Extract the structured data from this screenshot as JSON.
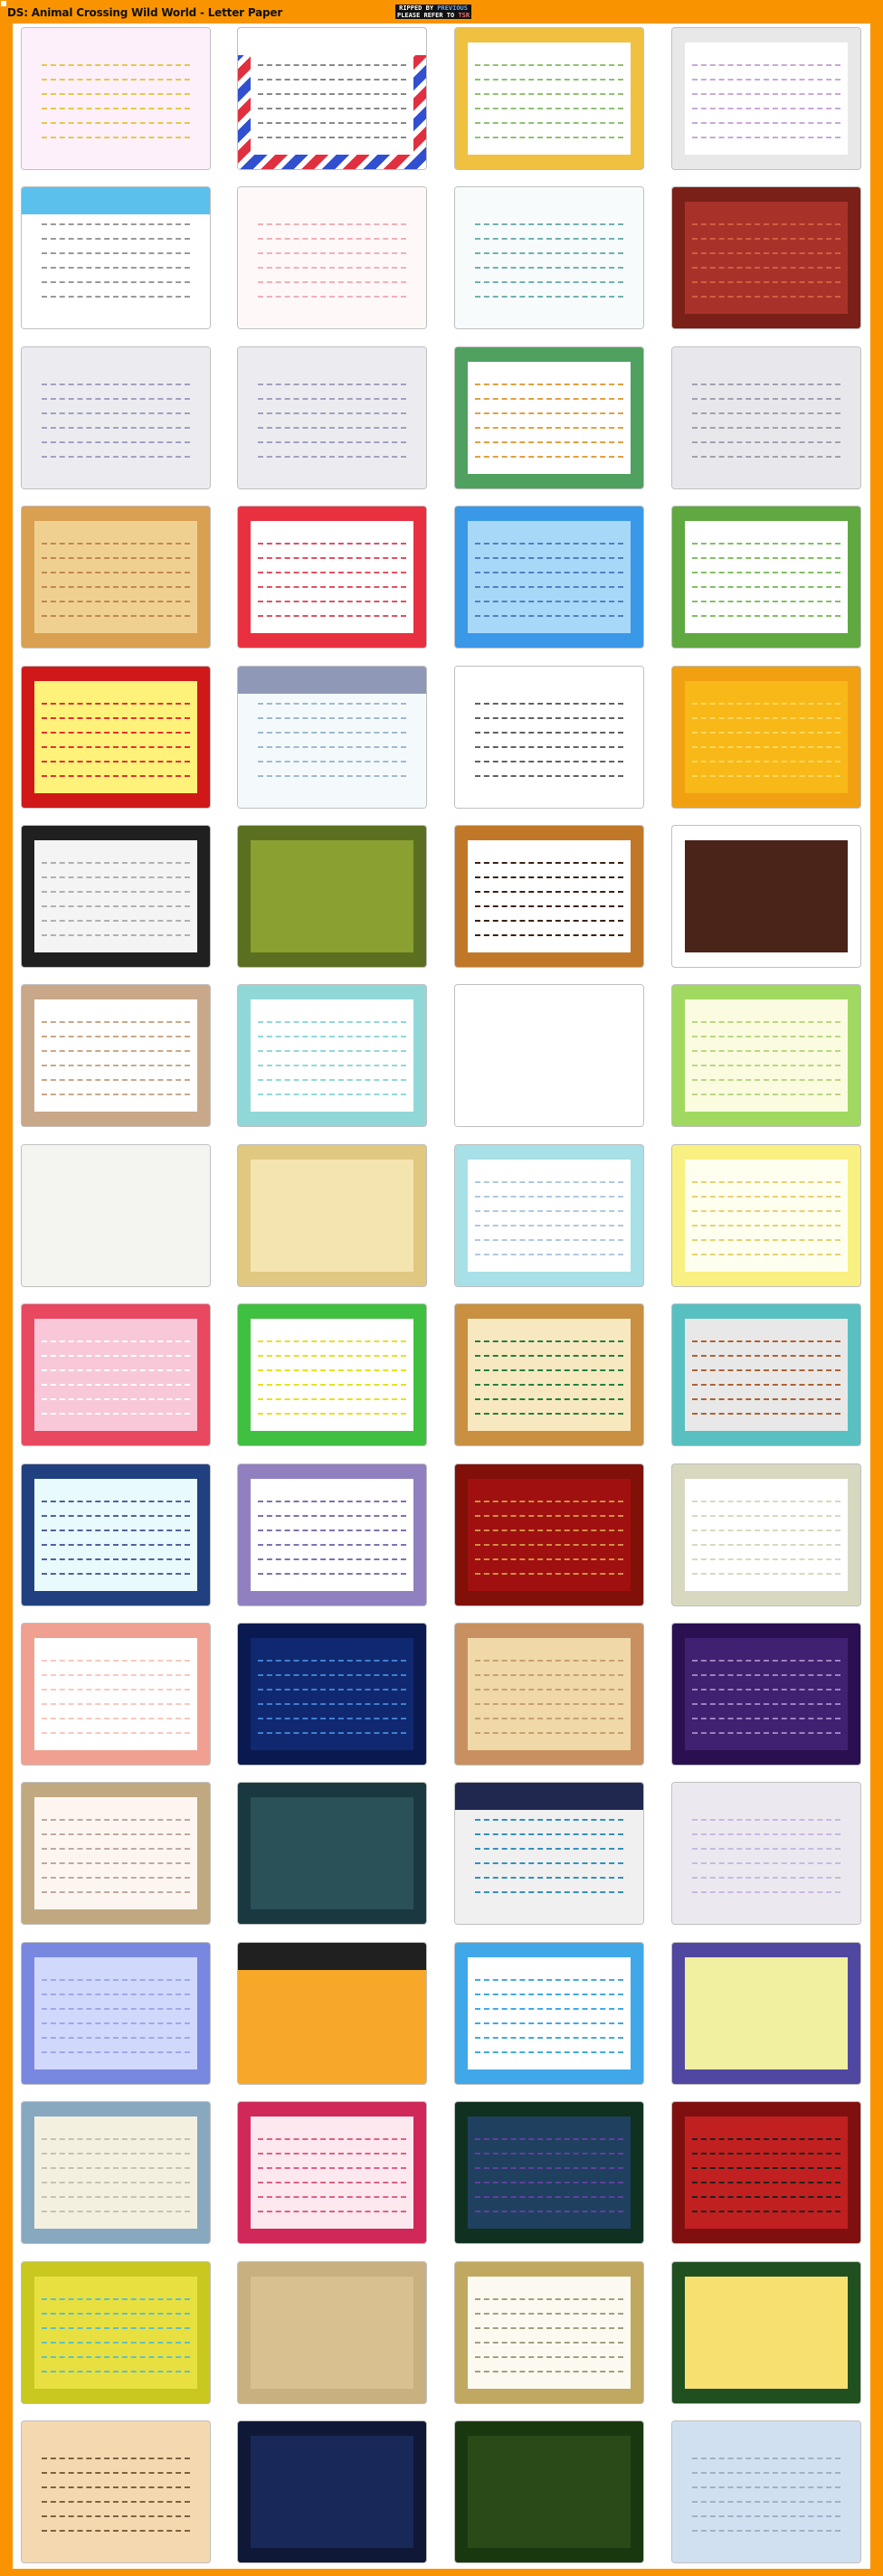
{
  "header": {
    "title": "DS: Animal Crossing Wild World - Letter Paper",
    "credit_line1_prefix": "RIPPED BY ",
    "credit_line1_name": "PREVIOUS",
    "credit_line2_prefix": "PLEASE REFER TO ",
    "credit_line2_name": "TSR"
  },
  "colors": {
    "background": "#f99400",
    "sheet": "#ffffff"
  },
  "papers": [
    {
      "bg": "#fdf0fa",
      "frame": "#fdf0fa",
      "line": "#e6c84a"
    },
    {
      "bg": "#ffffff",
      "frame": "#e03040",
      "band": "#ffffff",
      "line": "#888888",
      "stripe": "#3050d0"
    },
    {
      "bg": "#ffffff",
      "frame": "#f0c040",
      "line": "#90c070"
    },
    {
      "bg": "#ffffff",
      "frame": "#e8e8e8",
      "line": "#c8a8d8"
    },
    {
      "bg": "#ffffff",
      "frame": "#ffffff",
      "band": "#5bc0eb",
      "line": "#999999"
    },
    {
      "bg": "#fff8f8",
      "frame": "#fff8f8",
      "line": "#f0b0b8"
    },
    {
      "bg": "#f8fbfb",
      "frame": "#f8fbfb",
      "line": "#70b0b0"
    },
    {
      "bg": "#a8322a",
      "frame": "#7a2018",
      "line": "#d06040"
    },
    {
      "bg": "#ececf0",
      "frame": "#ececf0",
      "line": "#a0a0c0"
    },
    {
      "bg": "#ececf0",
      "frame": "#ececf0",
      "line": "#a0a0c0"
    },
    {
      "bg": "#ffffff",
      "frame": "#50a060",
      "line": "#e0a040"
    },
    {
      "bg": "#e8e8ec",
      "frame": "#e8e8ec",
      "line": "#a0a0b0"
    },
    {
      "bg": "#f0d090",
      "frame": "#d8a050",
      "line": "#c08850"
    },
    {
      "bg": "#ffffff",
      "frame": "#e83040",
      "line": "#e05060"
    },
    {
      "bg": "#a8d8f8",
      "frame": "#3a98e8",
      "line": "#5080c0"
    },
    {
      "bg": "#ffffff",
      "frame": "#60a840",
      "line": "#80c060"
    },
    {
      "bg": "#fff27a",
      "frame": "#d01818",
      "line": "#e03030"
    },
    {
      "bg": "#f4fafc",
      "frame": "#f4fafc",
      "band": "#9098b8",
      "line": "#a0b8d0"
    },
    {
      "bg": "#ffffff",
      "frame": "#ffffff",
      "line": "#606060"
    },
    {
      "bg": "#f8b818",
      "frame": "#f0a010",
      "line": "#f8d860"
    },
    {
      "bg": "#f4f4f4",
      "frame": "#202020",
      "line": "#b0b0b0"
    },
    {
      "bg": "#8aa030",
      "frame": "#5a7020",
      "line": "#8aa030"
    },
    {
      "bg": "#ffffff",
      "frame": "#c07828",
      "line": "#3a2010"
    },
    {
      "bg": "#4a2418",
      "frame": "#ffffff",
      "line": "#4a2418"
    },
    {
      "bg": "#ffffff",
      "frame": "#c8a888",
      "line": "#c8a888"
    },
    {
      "bg": "#ffffff",
      "frame": "#90d8d8",
      "line": "#90d8d8"
    },
    {
      "bg": "#ffffff",
      "frame": "#ffffff",
      "line": "#ffffff"
    },
    {
      "bg": "#fbfbe0",
      "frame": "#a0d860",
      "line": "#b8d880"
    },
    {
      "bg": "#f4f4f0",
      "frame": "#f4f4f0",
      "line": "#f4f4f0"
    },
    {
      "bg": "#f4e4b0",
      "frame": "#e0c880",
      "line": "#f4e4b0"
    },
    {
      "bg": "#ffffff",
      "frame": "#a8e0e8",
      "line": "#b0c8e0"
    },
    {
      "bg": "#fffff0",
      "frame": "#f8f080",
      "line": "#e8d070"
    },
    {
      "bg": "#f8c8d8",
      "frame": "#e84860",
      "line": "#ffffff"
    },
    {
      "bg": "#ffffff",
      "frame": "#40c040",
      "line": "#e8e020"
    },
    {
      "bg": "#f8e8c0",
      "frame": "#c89040",
      "line": "#208040"
    },
    {
      "bg": "#e8e8e8",
      "frame": "#58c0c0",
      "line": "#b06030"
    },
    {
      "bg": "#e8fafc",
      "frame": "#204080",
      "line": "#5060a0"
    },
    {
      "bg": "#ffffff",
      "frame": "#9080c0",
      "line": "#8070b0"
    },
    {
      "bg": "#a01010",
      "frame": "#801008",
      "line": "#d09040"
    },
    {
      "bg": "#ffffff",
      "frame": "#d8d8c0",
      "line": "#d8d8c0"
    },
    {
      "bg": "#ffffff",
      "frame": "#f0a090",
      "line": "#f8c8c0"
    },
    {
      "bg": "#102870",
      "frame": "#0a1a50",
      "line": "#4080d0"
    },
    {
      "bg": "#f0d8a8",
      "frame": "#c89060",
      "line": "#c8a070"
    },
    {
      "bg": "#402070",
      "frame": "#2a1050",
      "line": "#a080c0"
    },
    {
      "bg": "#fdf6f0",
      "frame": "#c0a880",
      "line": "#c0a8a0"
    },
    {
      "bg": "#2a5058",
      "frame": "#1a3840",
      "line": "#2a5058"
    },
    {
      "bg": "#f0f0f0",
      "frame": "#f0f0f0",
      "band": "#202850",
      "line": "#3090c0"
    },
    {
      "bg": "#ece8f0",
      "frame": "#ece8f0",
      "line": "#c8b8e0"
    },
    {
      "bg": "#d0d8fc",
      "frame": "#7888e0",
      "line": "#a0a8e8"
    },
    {
      "bg": "#f8a828",
      "frame": "#f8a828",
      "band": "#202020",
      "line": "#f8a828"
    },
    {
      "bg": "#ffffff",
      "frame": "#40a8e8",
      "line": "#40a8e8"
    },
    {
      "bg": "#f0f0a0",
      "frame": "#5048a0",
      "line": "#f0f0a0"
    },
    {
      "bg": "#f4f0e0",
      "frame": "#88a8c0",
      "line": "#c8c0b0"
    },
    {
      "bg": "#fde8f0",
      "frame": "#d02858",
      "line": "#e06080"
    },
    {
      "bg": "#204060",
      "frame": "#103020",
      "line": "#6040a0"
    },
    {
      "bg": "#c02020",
      "frame": "#801010",
      "line": "#202020"
    },
    {
      "bg": "#e8e040",
      "frame": "#c8c820",
      "line": "#60c0c0"
    },
    {
      "bg": "#d8c090",
      "frame": "#c8b080",
      "line": "#d8c090"
    },
    {
      "bg": "#fcfaf0",
      "frame": "#c0a860",
      "line": "#a0a080"
    },
    {
      "bg": "#f8e070",
      "frame": "#205020",
      "line": "#f8e070"
    },
    {
      "bg": "#f4d8b0",
      "frame": "#f4d8b0",
      "line": "#806040"
    },
    {
      "bg": "#182858",
      "frame": "#101838",
      "line": "#182858"
    },
    {
      "bg": "#2a4a18",
      "frame": "#1a3810",
      "line": "#2a4a18"
    },
    {
      "bg": "#d0e0f0",
      "frame": "#d0e0f0",
      "line": "#a0b0c8"
    }
  ]
}
